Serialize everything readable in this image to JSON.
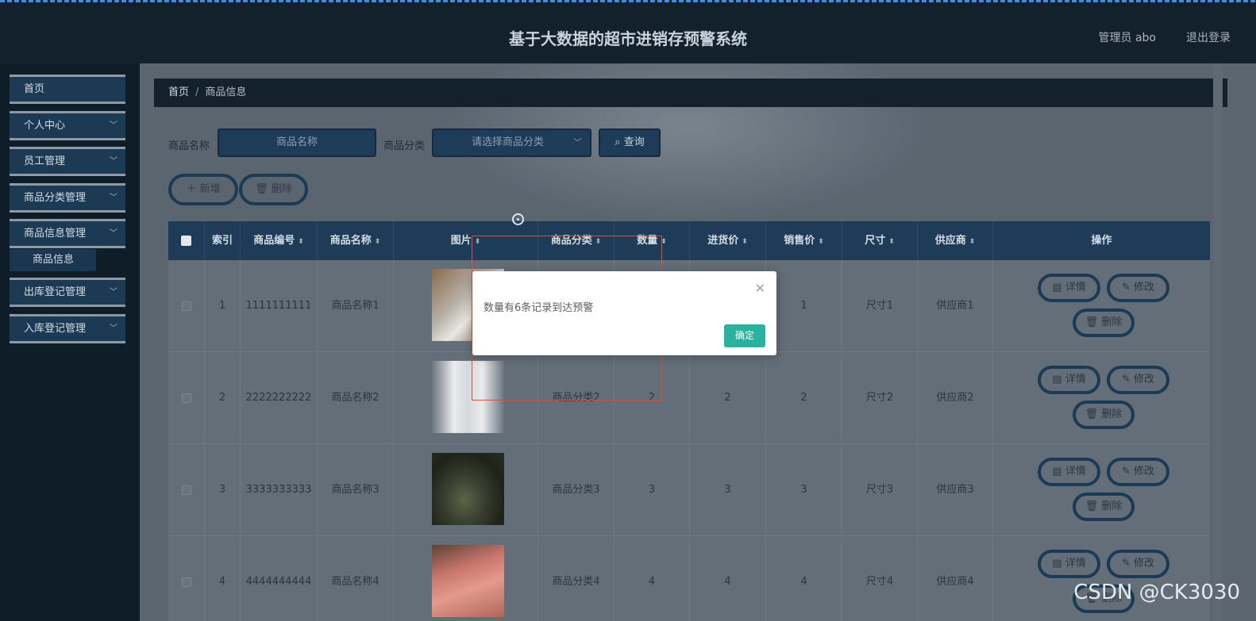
{
  "header": {
    "title": "基于大数据的超市进销存预警系统",
    "user": "管理员 abo",
    "logout": "退出登录"
  },
  "sidebar": {
    "items": [
      {
        "label": "首页",
        "has_chevron": false
      },
      {
        "label": "个人中心",
        "has_chevron": true
      },
      {
        "label": "员工管理",
        "has_chevron": true
      },
      {
        "label": "商品分类管理",
        "has_chevron": true
      },
      {
        "label": "商品信息管理",
        "has_chevron": true
      },
      {
        "label": "出库登记管理",
        "has_chevron": true
      },
      {
        "label": "入库登记管理",
        "has_chevron": true
      }
    ],
    "sub_item": "商品信息"
  },
  "breadcrumb": {
    "home": "首页",
    "sep": "/",
    "current": "商品信息"
  },
  "search": {
    "name_label": "商品名称",
    "name_placeholder": "商品名称",
    "category_label": "商品分类",
    "category_placeholder": "请选择商品分类",
    "search_button": "查询"
  },
  "actions": {
    "add": "新增",
    "delete": "删除"
  },
  "table": {
    "headers": [
      "索引",
      "商品编号",
      "商品名称",
      "图片",
      "商品分类",
      "数量",
      "进货价",
      "销售价",
      "尺寸",
      "供应商",
      "操作"
    ],
    "rows": [
      {
        "index": "1",
        "code": "1111111111",
        "name": "商品名称1",
        "category": "",
        "qty": "",
        "buy": "",
        "sell": "1",
        "size": "尺寸1",
        "supplier": "供应商1"
      },
      {
        "index": "2",
        "code": "2222222222",
        "name": "商品名称2",
        "category": "商品分类2",
        "qty": "2",
        "buy": "2",
        "sell": "2",
        "size": "尺寸2",
        "supplier": "供应商2"
      },
      {
        "index": "3",
        "code": "3333333333",
        "name": "商品名称3",
        "category": "商品分类3",
        "qty": "3",
        "buy": "3",
        "sell": "3",
        "size": "尺寸3",
        "supplier": "供应商3"
      },
      {
        "index": "4",
        "code": "4444444444",
        "name": "商品名称4",
        "category": "商品分类4",
        "qty": "4",
        "buy": "4",
        "sell": "4",
        "size": "尺寸4",
        "supplier": "供应商4"
      }
    ],
    "ops": {
      "detail": "详情",
      "edit": "修改",
      "delete": "删除"
    }
  },
  "dialog": {
    "message": "数量有6条记录到达预警",
    "ok": "确定"
  },
  "watermark": "CSDN @CK3030",
  "colors": {
    "header_bg": "#13212d",
    "accent": "#1e3b58",
    "ok_button": "#2ab29f"
  }
}
